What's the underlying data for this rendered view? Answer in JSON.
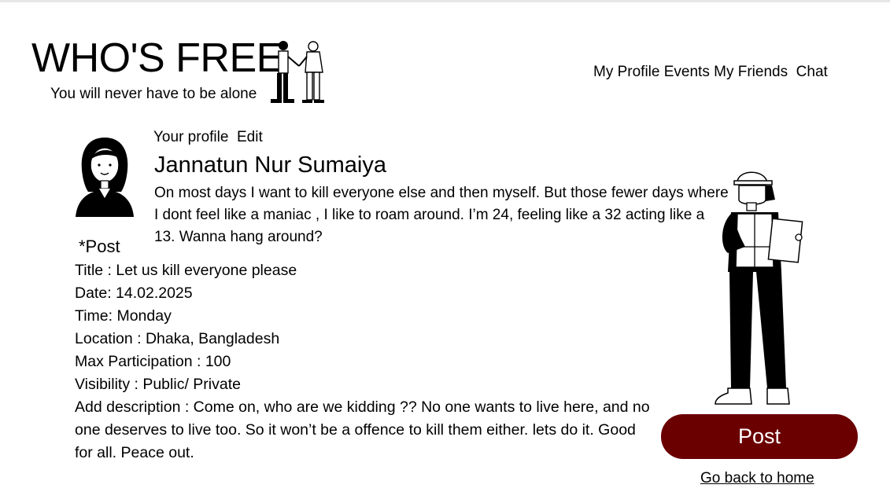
{
  "brand": {
    "title": "WHO'S FREE",
    "tagline": "You will never have to be alone"
  },
  "nav": {
    "items": [
      "My Profile",
      "Events",
      "My Friends",
      "Chat"
    ]
  },
  "profile": {
    "heading": "Your profile",
    "edit_label": "Edit",
    "name": "Jannatun Nur Sumaiya",
    "bio": "On most days I want to kill everyone else and then myself. But those fewer days where I dont feel like a maniac , I like to roam around. I’m 24, feeling like a 32 acting like a 13. Wanna hang around?"
  },
  "post": {
    "marker": "*Post",
    "title_line": "Title : Let us kill everyone please",
    "date_line": "Date: 14.02.2025",
    "time_line": "Time: Monday",
    "location_line": "Location : Dhaka, Bangladesh",
    "max_participation_line": "Max Participation : 100",
    "visibility_line": "Visibility :  Public/ Private",
    "description_label": "Add description : ",
    "description": " Come on, who are we kidding ?? No one wants to live here, and no one deserves to live too. So it won’t be a offence to kill them either. lets do it. Good for all. Peace out."
  },
  "actions": {
    "post_button": "Post",
    "back_home": "Go back to home"
  },
  "colors": {
    "accent": "#6b0000"
  },
  "icons": {
    "avatar": "woman-avatar-icon",
    "hero": "handshake-illustration",
    "worker": "worker-clipboard-illustration"
  }
}
